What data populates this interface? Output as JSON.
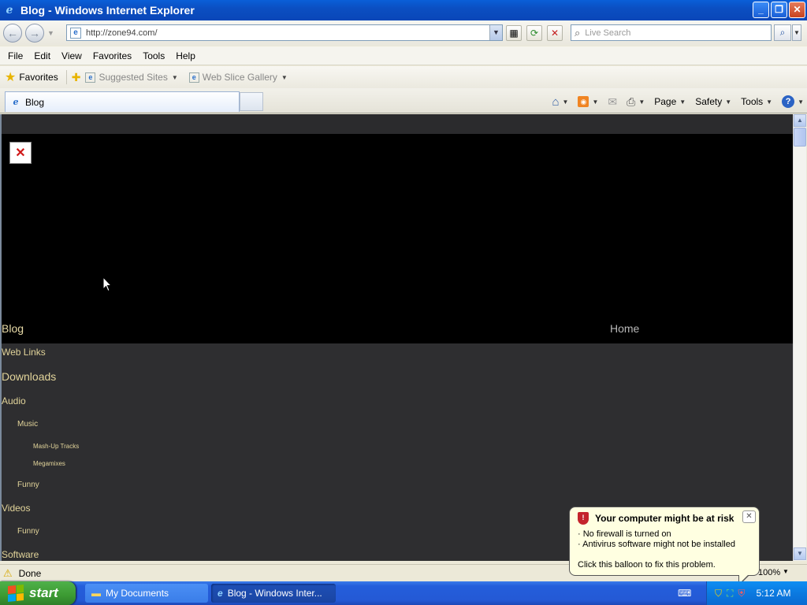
{
  "window": {
    "title": "Blog - Windows Internet Explorer"
  },
  "address_bar": {
    "url": "http://zone94.com/"
  },
  "search": {
    "placeholder": "Live Search"
  },
  "menu": [
    "File",
    "Edit",
    "View",
    "Favorites",
    "Tools",
    "Help"
  ],
  "favorites_bar": {
    "favorites_label": "Favorites",
    "suggested_sites": "Suggested Sites",
    "web_slice_gallery": "Web Slice Gallery"
  },
  "tab": {
    "label": "Blog"
  },
  "command_bar": {
    "page": "Page",
    "safety": "Safety",
    "tools": "Tools"
  },
  "page": {
    "site_title": "Blog",
    "home_link": "Home",
    "nav": {
      "web_links": "Web Links",
      "downloads": "Downloads",
      "audio": "Audio",
      "music": "Music",
      "mashup_tracks": "Mash-Up Tracks",
      "megamixes": "Megamixes",
      "audio_funny": "Funny",
      "videos": "Videos",
      "videos_funny": "Funny",
      "software": "Software"
    }
  },
  "status_bar": {
    "status": "Done",
    "zoom": "100%"
  },
  "balloon": {
    "title": "Your computer might be at risk",
    "line1": "No firewall is turned on",
    "line2": "Antivirus software might not be installed",
    "action": "Click this balloon to fix this problem."
  },
  "taskbar": {
    "start": "start",
    "task1": "My Documents",
    "task2": "Blog - Windows Inter...",
    "clock": "5:12 AM"
  },
  "colors": {
    "link": "#e2d49a",
    "page_bg": "#2e2e30",
    "header_bg": "#000000"
  }
}
